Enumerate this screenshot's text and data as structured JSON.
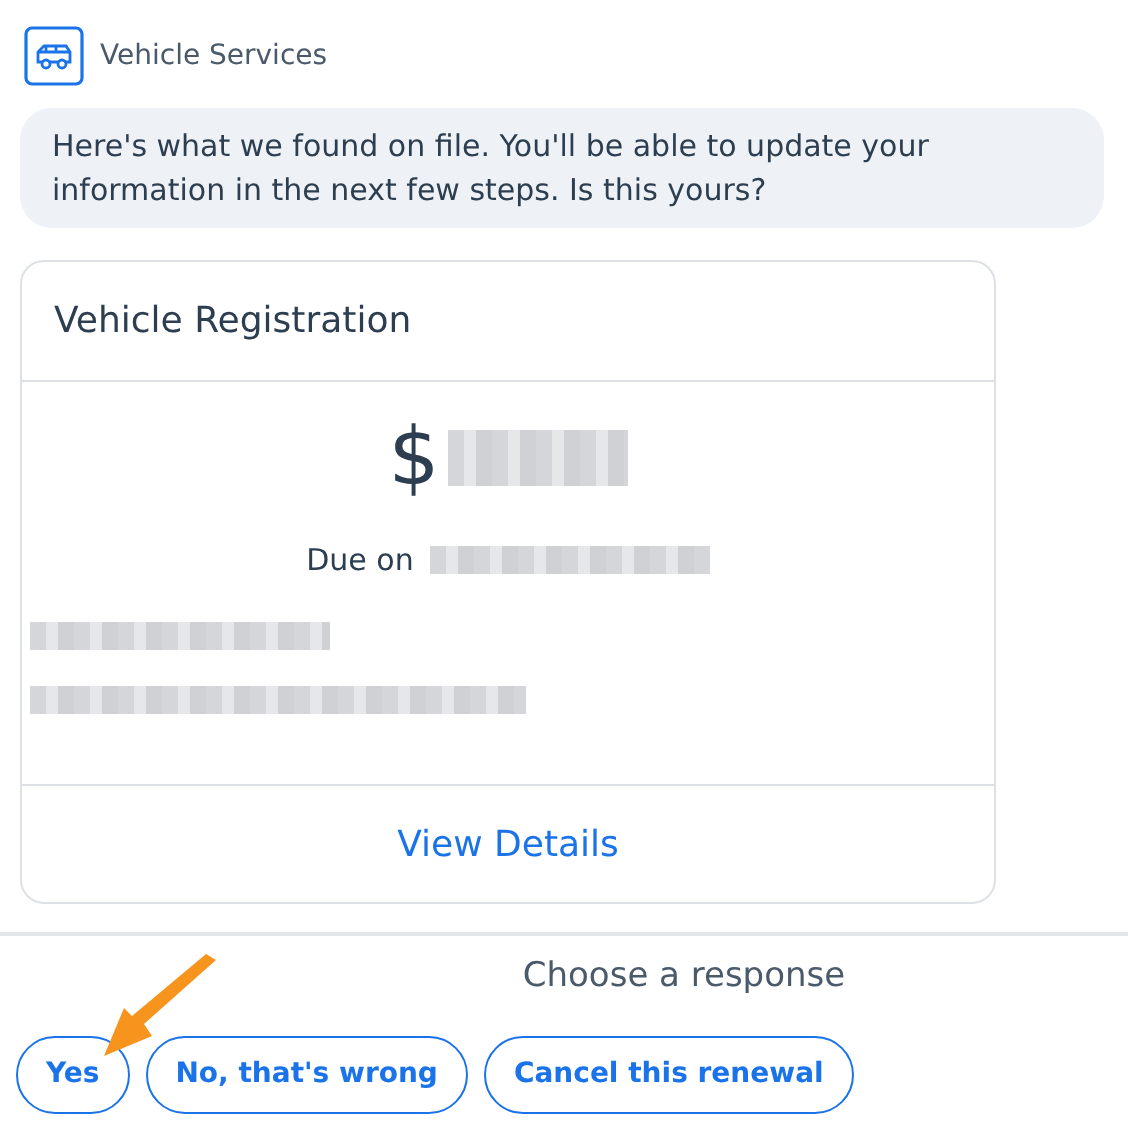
{
  "header": {
    "title": "Vehicle Services"
  },
  "message": "Here's what we found on file. You'll be able to update your information in the next few steps. Is this yours?",
  "card": {
    "title": "Vehicle Registration",
    "amount_symbol": "$",
    "due_label": "Due on",
    "link": "View Details"
  },
  "prompt": "Choose a response",
  "responses": [
    {
      "label": "Yes",
      "pointed": true
    },
    {
      "label": "No, that's wrong",
      "pointed": false
    },
    {
      "label": "Cancel this renewal",
      "pointed": false
    }
  ]
}
